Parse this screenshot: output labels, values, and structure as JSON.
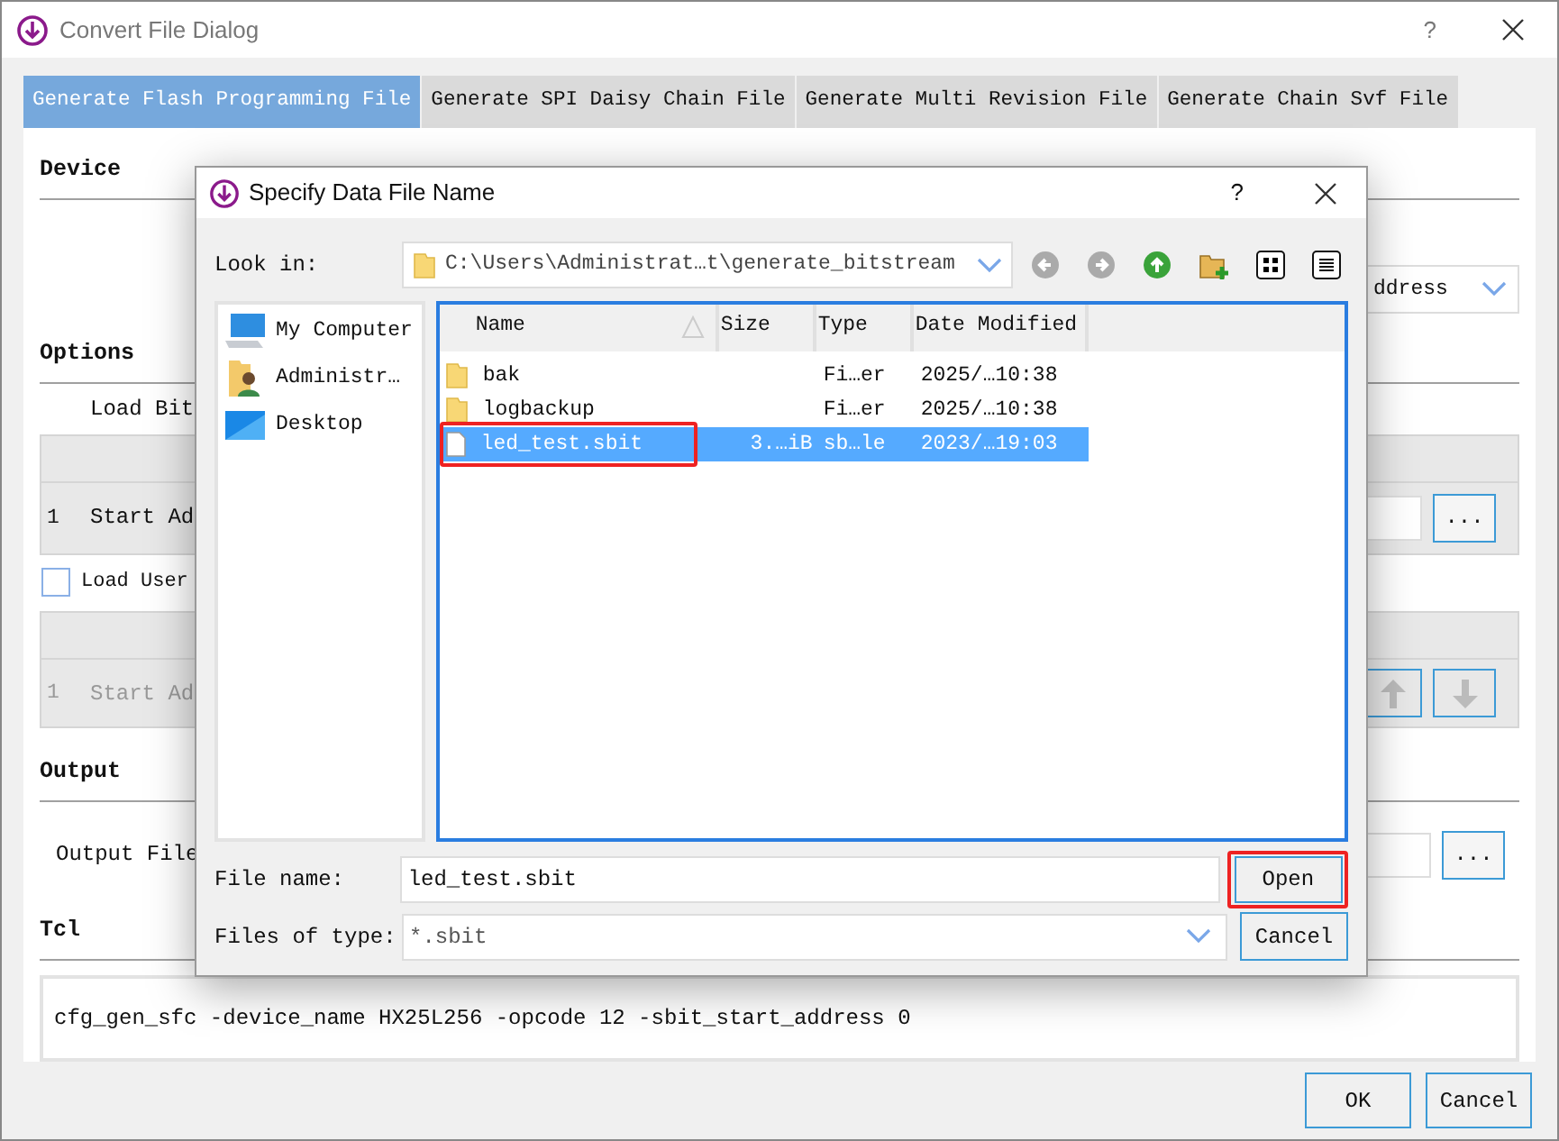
{
  "window": {
    "title": "Convert File Dialog",
    "help": "?"
  },
  "tabs": [
    {
      "label": "Generate Flash Programming File",
      "selected": true
    },
    {
      "label": "Generate SPI Daisy Chain File",
      "selected": false
    },
    {
      "label": "Generate Multi Revision File",
      "selected": false
    },
    {
      "label": "Generate Chain Svf File",
      "selected": false
    }
  ],
  "device": {
    "heading": "Device",
    "dropdown_value": "ddress"
  },
  "options": {
    "heading": "Options",
    "load_bit_label": "Load Bit",
    "table1": {
      "row_number": "1",
      "row_label": "Start Ad",
      "browse": "..."
    },
    "load_user": {
      "label": "Load User",
      "checked": false
    },
    "table2": {
      "row_number": "1",
      "row_label": "Start Ad",
      "disabled": true
    }
  },
  "output": {
    "heading": "Output",
    "label": "Output File",
    "browse": "..."
  },
  "tcl": {
    "heading": "Tcl",
    "command": "cfg_gen_sfc -device_name HX25L256 -opcode 12 -sbit_start_address 0"
  },
  "buttons": [
    {
      "label": "OK"
    },
    {
      "label": "Cancel"
    }
  ],
  "dialog": {
    "title": "Specify Data File Name",
    "help": "?",
    "look_in": {
      "label": "Look in:",
      "path": "C:\\Users\\Administrat…t\\generate_bitstream"
    },
    "places": [
      {
        "kind": "computer",
        "label": "My Computer"
      },
      {
        "kind": "user",
        "label": "Administr…"
      },
      {
        "kind": "desktop",
        "label": "Desktop"
      }
    ],
    "columns": [
      {
        "label": "Name",
        "sorted": true
      },
      {
        "label": "Size",
        "sorted": false
      },
      {
        "label": "Type",
        "sorted": false
      },
      {
        "label": "Date Modified",
        "sorted": false
      }
    ],
    "files": [
      {
        "kind": "folder",
        "name": "bak",
        "type": "Fi…er",
        "date": "2025/…10:38",
        "selected": false,
        "highlighted": false
      },
      {
        "kind": "folder",
        "name": "logbackup",
        "type": "Fi…er",
        "date": "2025/…10:38",
        "selected": false,
        "highlighted": false
      },
      {
        "kind": "file",
        "name": "led_test.sbit",
        "size": "3.…iB",
        "type": "sb…le",
        "date": "2023/…19:03",
        "selected": true,
        "highlighted": true
      }
    ],
    "file_name": {
      "label": "File name:",
      "value": "led_test.sbit"
    },
    "file_type": {
      "label": "Files of type:",
      "value": "*.sbit"
    },
    "open_button": {
      "label": "Open",
      "highlighted": true
    },
    "cancel_button": {
      "label": "Cancel"
    }
  }
}
